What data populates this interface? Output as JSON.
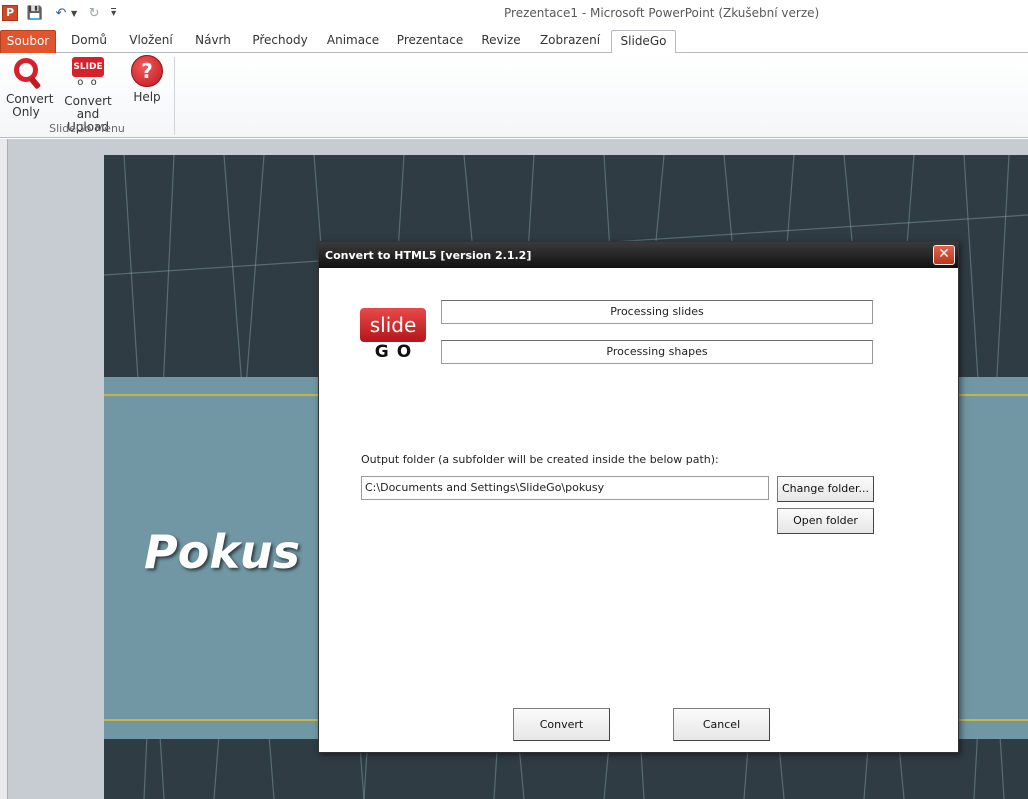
{
  "window": {
    "title": "Prezentace1  -  Microsoft PowerPoint (Zkušební verze)",
    "app_icon": "P"
  },
  "quick_access": {
    "save_icon": "💾",
    "undo_icon": "↶",
    "redo_icon": "↻"
  },
  "tabs": [
    {
      "label": "Soubor"
    },
    {
      "label": "Domů"
    },
    {
      "label": "Vložení"
    },
    {
      "label": "Návrh"
    },
    {
      "label": "Přechody"
    },
    {
      "label": "Animace"
    },
    {
      "label": "Prezentace"
    },
    {
      "label": "Revize"
    },
    {
      "label": "Zobrazení"
    },
    {
      "label": "SlideGo"
    }
  ],
  "ribbon": {
    "group_label": "SlideGo Menu",
    "buttons": [
      {
        "line1": "Convert",
        "line2": "Only"
      },
      {
        "line1": "Convert",
        "line2": "and Upload",
        "icon_text": "SLIDE",
        "icon_wheels": "o o"
      },
      {
        "line1": "Help",
        "icon_text": "?"
      }
    ]
  },
  "slide": {
    "title": "Pokus"
  },
  "dialog": {
    "title": "Convert to HTML5 [version 2.1.2]",
    "close_symbol": "✕",
    "logo_top": "slide",
    "logo_bottom": "GO",
    "status_slides": "Processing slides",
    "status_shapes": "Processing shapes",
    "output_label": "Output folder (a subfolder will be created inside the below path):",
    "output_path": "C:\\Documents and Settings\\SlideGo\\pokusy",
    "change_folder": "Change folder...",
    "open_folder": "Open folder",
    "convert": "Convert",
    "cancel": "Cancel"
  },
  "colors": {
    "file_tab": "#e0552e",
    "brand_red": "#d8202a",
    "slide_band": "#7197a4",
    "slide_background": "#2f3c44",
    "accent_rule": "#c8b642"
  }
}
